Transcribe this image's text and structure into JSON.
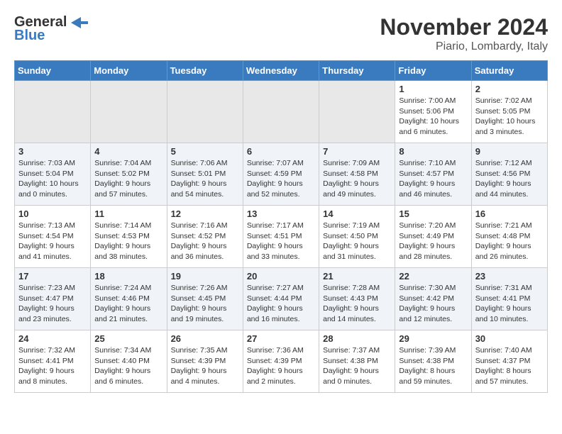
{
  "header": {
    "logo_general": "General",
    "logo_blue": "Blue",
    "month_title": "November 2024",
    "location": "Piario, Lombardy, Italy"
  },
  "weekdays": [
    "Sunday",
    "Monday",
    "Tuesday",
    "Wednesday",
    "Thursday",
    "Friday",
    "Saturday"
  ],
  "weeks": [
    [
      {
        "day": "",
        "empty": true
      },
      {
        "day": "",
        "empty": true
      },
      {
        "day": "",
        "empty": true
      },
      {
        "day": "",
        "empty": true
      },
      {
        "day": "",
        "empty": true
      },
      {
        "day": "1",
        "sunrise": "Sunrise: 7:00 AM",
        "sunset": "Sunset: 5:06 PM",
        "daylight": "Daylight: 10 hours and 6 minutes."
      },
      {
        "day": "2",
        "sunrise": "Sunrise: 7:02 AM",
        "sunset": "Sunset: 5:05 PM",
        "daylight": "Daylight: 10 hours and 3 minutes."
      }
    ],
    [
      {
        "day": "3",
        "sunrise": "Sunrise: 7:03 AM",
        "sunset": "Sunset: 5:04 PM",
        "daylight": "Daylight: 10 hours and 0 minutes."
      },
      {
        "day": "4",
        "sunrise": "Sunrise: 7:04 AM",
        "sunset": "Sunset: 5:02 PM",
        "daylight": "Daylight: 9 hours and 57 minutes."
      },
      {
        "day": "5",
        "sunrise": "Sunrise: 7:06 AM",
        "sunset": "Sunset: 5:01 PM",
        "daylight": "Daylight: 9 hours and 54 minutes."
      },
      {
        "day": "6",
        "sunrise": "Sunrise: 7:07 AM",
        "sunset": "Sunset: 4:59 PM",
        "daylight": "Daylight: 9 hours and 52 minutes."
      },
      {
        "day": "7",
        "sunrise": "Sunrise: 7:09 AM",
        "sunset": "Sunset: 4:58 PM",
        "daylight": "Daylight: 9 hours and 49 minutes."
      },
      {
        "day": "8",
        "sunrise": "Sunrise: 7:10 AM",
        "sunset": "Sunset: 4:57 PM",
        "daylight": "Daylight: 9 hours and 46 minutes."
      },
      {
        "day": "9",
        "sunrise": "Sunrise: 7:12 AM",
        "sunset": "Sunset: 4:56 PM",
        "daylight": "Daylight: 9 hours and 44 minutes."
      }
    ],
    [
      {
        "day": "10",
        "sunrise": "Sunrise: 7:13 AM",
        "sunset": "Sunset: 4:54 PM",
        "daylight": "Daylight: 9 hours and 41 minutes."
      },
      {
        "day": "11",
        "sunrise": "Sunrise: 7:14 AM",
        "sunset": "Sunset: 4:53 PM",
        "daylight": "Daylight: 9 hours and 38 minutes."
      },
      {
        "day": "12",
        "sunrise": "Sunrise: 7:16 AM",
        "sunset": "Sunset: 4:52 PM",
        "daylight": "Daylight: 9 hours and 36 minutes."
      },
      {
        "day": "13",
        "sunrise": "Sunrise: 7:17 AM",
        "sunset": "Sunset: 4:51 PM",
        "daylight": "Daylight: 9 hours and 33 minutes."
      },
      {
        "day": "14",
        "sunrise": "Sunrise: 7:19 AM",
        "sunset": "Sunset: 4:50 PM",
        "daylight": "Daylight: 9 hours and 31 minutes."
      },
      {
        "day": "15",
        "sunrise": "Sunrise: 7:20 AM",
        "sunset": "Sunset: 4:49 PM",
        "daylight": "Daylight: 9 hours and 28 minutes."
      },
      {
        "day": "16",
        "sunrise": "Sunrise: 7:21 AM",
        "sunset": "Sunset: 4:48 PM",
        "daylight": "Daylight: 9 hours and 26 minutes."
      }
    ],
    [
      {
        "day": "17",
        "sunrise": "Sunrise: 7:23 AM",
        "sunset": "Sunset: 4:47 PM",
        "daylight": "Daylight: 9 hours and 23 minutes."
      },
      {
        "day": "18",
        "sunrise": "Sunrise: 7:24 AM",
        "sunset": "Sunset: 4:46 PM",
        "daylight": "Daylight: 9 hours and 21 minutes."
      },
      {
        "day": "19",
        "sunrise": "Sunrise: 7:26 AM",
        "sunset": "Sunset: 4:45 PM",
        "daylight": "Daylight: 9 hours and 19 minutes."
      },
      {
        "day": "20",
        "sunrise": "Sunrise: 7:27 AM",
        "sunset": "Sunset: 4:44 PM",
        "daylight": "Daylight: 9 hours and 16 minutes."
      },
      {
        "day": "21",
        "sunrise": "Sunrise: 7:28 AM",
        "sunset": "Sunset: 4:43 PM",
        "daylight": "Daylight: 9 hours and 14 minutes."
      },
      {
        "day": "22",
        "sunrise": "Sunrise: 7:30 AM",
        "sunset": "Sunset: 4:42 PM",
        "daylight": "Daylight: 9 hours and 12 minutes."
      },
      {
        "day": "23",
        "sunrise": "Sunrise: 7:31 AM",
        "sunset": "Sunset: 4:41 PM",
        "daylight": "Daylight: 9 hours and 10 minutes."
      }
    ],
    [
      {
        "day": "24",
        "sunrise": "Sunrise: 7:32 AM",
        "sunset": "Sunset: 4:41 PM",
        "daylight": "Daylight: 9 hours and 8 minutes."
      },
      {
        "day": "25",
        "sunrise": "Sunrise: 7:34 AM",
        "sunset": "Sunset: 4:40 PM",
        "daylight": "Daylight: 9 hours and 6 minutes."
      },
      {
        "day": "26",
        "sunrise": "Sunrise: 7:35 AM",
        "sunset": "Sunset: 4:39 PM",
        "daylight": "Daylight: 9 hours and 4 minutes."
      },
      {
        "day": "27",
        "sunrise": "Sunrise: 7:36 AM",
        "sunset": "Sunset: 4:39 PM",
        "daylight": "Daylight: 9 hours and 2 minutes."
      },
      {
        "day": "28",
        "sunrise": "Sunrise: 7:37 AM",
        "sunset": "Sunset: 4:38 PM",
        "daylight": "Daylight: 9 hours and 0 minutes."
      },
      {
        "day": "29",
        "sunrise": "Sunrise: 7:39 AM",
        "sunset": "Sunset: 4:38 PM",
        "daylight": "Daylight: 8 hours and 59 minutes."
      },
      {
        "day": "30",
        "sunrise": "Sunrise: 7:40 AM",
        "sunset": "Sunset: 4:37 PM",
        "daylight": "Daylight: 8 hours and 57 minutes."
      }
    ]
  ]
}
